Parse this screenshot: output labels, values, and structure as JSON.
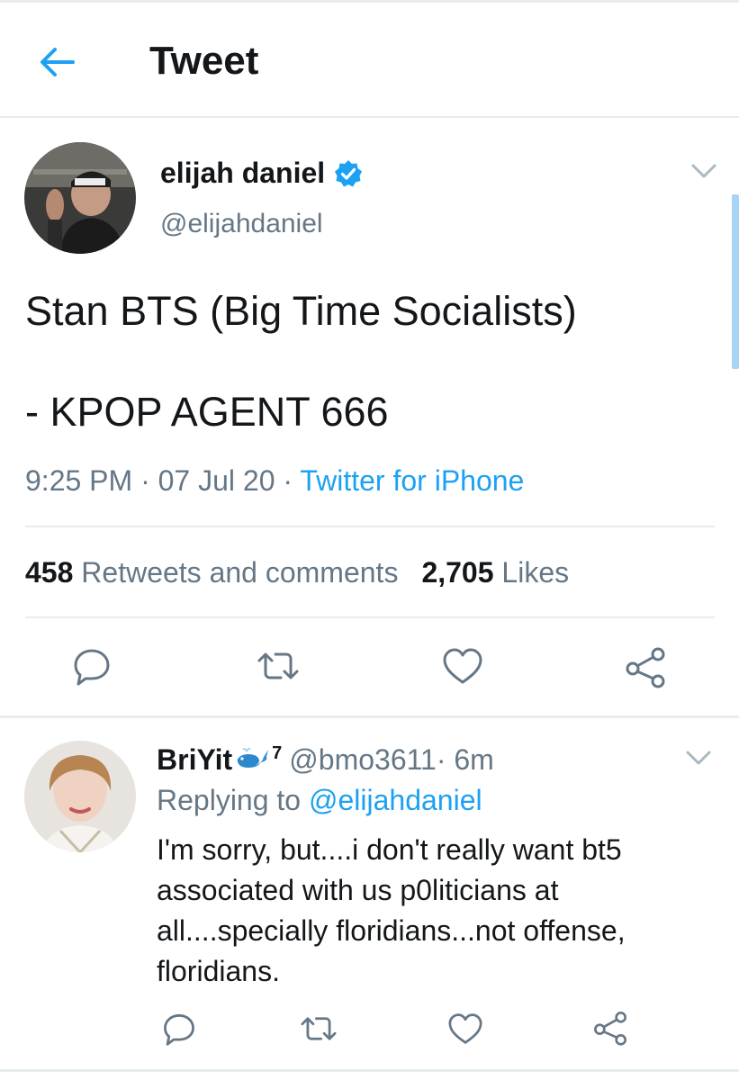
{
  "colors": {
    "accent": "#1da1f2",
    "text_primary": "#14171a",
    "text_secondary": "#657786",
    "divider": "#e6ecf0",
    "icon": "#657786"
  },
  "header": {
    "title": "Tweet",
    "back_icon": "arrow-left-icon"
  },
  "tweet": {
    "author": {
      "name": "elijah daniel",
      "handle": "@elijahdaniel",
      "verified": true
    },
    "text_lines": [
      "Stan BTS (Big Time Socialists)",
      "- KPOP AGENT 666"
    ],
    "meta": {
      "time": "9:25 PM",
      "date": "07 Jul 20",
      "source": "Twitter for iPhone",
      "sep": " · "
    },
    "stats": {
      "retweets_count": "458",
      "retweets_label": "Retweets and comments",
      "likes_count": "2,705",
      "likes_label": "Likes"
    },
    "actions": [
      "reply-icon",
      "retweet-icon",
      "like-icon",
      "share-icon"
    ]
  },
  "reply": {
    "author": {
      "name": "BriYit",
      "superscript": "7",
      "handle": "@bmo3611",
      "time": " · 6m"
    },
    "replying_label": "Replying to",
    "replying_mention": "@elijahdaniel",
    "text_lines": [
      "I'm sorry, but....i don't really want bt5",
      "associated with us p0liticians at",
      "all....specially floridians...not offense,",
      "floridians."
    ],
    "actions": [
      "reply-icon",
      "retweet-icon",
      "like-icon",
      "share-icon"
    ]
  }
}
